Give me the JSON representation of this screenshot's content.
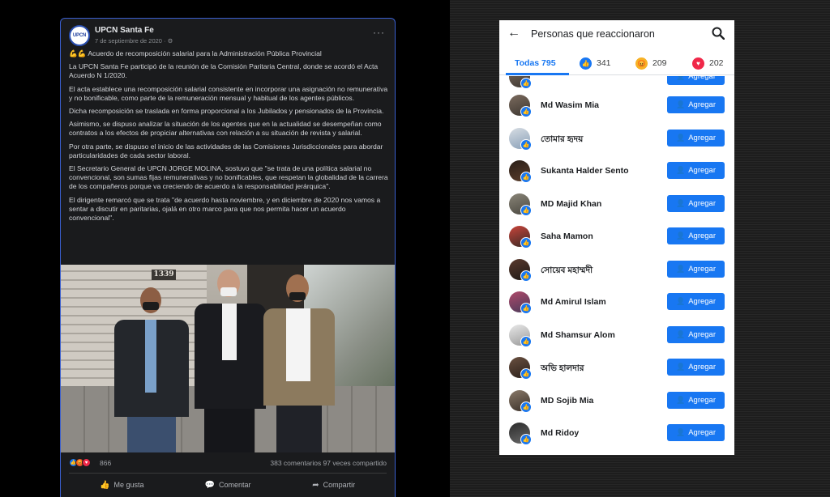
{
  "post": {
    "page_name": "UPCN Santa Fe",
    "logo_text": "UPCN",
    "date": "7 de septiembre de 2020 · ⚙",
    "more": "···",
    "paragraphs": [
      "💪💪 Acuerdo de recomposición salarial para la Administración Pública Provincial",
      "La UPCN Santa Fe participó de la reunión de la Comisión Paritaria Central, donde se acordó el Acta Acuerdo N 1/2020.",
      "El acta establece una recomposición salarial consistente en incorporar una asignación no remunerativa y no bonificable, como parte de la remuneración mensual y habitual de los agentes públicos.",
      "Dicha recomposición se traslada en forma proporcional a los Jubilados y pensionados de la Provincia.",
      "Asimismo, se dispuso analizar la situación de los agentes que en la actualidad se desempeñan como contratos a los efectos de propiciar alternativas con relación a su situación de revista y salarial.",
      "Por otra parte, se dispuso el inicio de las actividades de las Comisiones Jurisdiccionales para abordar particularidades de cada sector laboral.",
      "El Secretario General de UPCN JORGE MOLINA, sostuvo que \"se trata de una política salarial no convencional, son sumas fijas remunerativas y no bonificables, que respetan la globalidad de la carrera de los compañeros porque va creciendo de acuerdo a la responsabilidad jerárquica\".",
      "El dirigente remarcó que se trata \"de acuerdo hasta noviembre, y en diciembre de 2020 nos vamos a sentar a discutir en paritarias, ojalá en otro marco para que nos permita hacer un acuerdo convencional\"."
    ],
    "photo_number": "1339",
    "reaction_count": "866",
    "engagement": "383 comentarios  97 veces compartido",
    "actions": {
      "like": "Me gusta",
      "comment": "Comentar",
      "share": "Compartir"
    }
  },
  "panel": {
    "title": "Personas que reaccionaron",
    "tabs": {
      "all": "Todas 795",
      "like": "341",
      "angry": "209",
      "love": "202"
    },
    "add_label": "Agregar",
    "people": [
      "Md Wasim Mia",
      "তোমার হৃদয়",
      "Sukanta Halder Sento",
      "MD Majid Khan",
      "Saha Mamon",
      "সোয়েব মহাম্মদী",
      "Md Amirul Islam",
      "Md Shamsur Alom",
      "অভি হালদার",
      "MD Sojib Mia",
      "Md Ridoy"
    ]
  },
  "colors": {
    "accent": "#1877f2",
    "post_border": "#3a5fcf",
    "post_bg": "#1a1b1d"
  },
  "icons": [
    "back-arrow-icon",
    "search-icon",
    "like-icon",
    "angry-icon",
    "love-icon",
    "add-friend-icon",
    "more-icon",
    "comment-icon",
    "share-icon"
  ]
}
